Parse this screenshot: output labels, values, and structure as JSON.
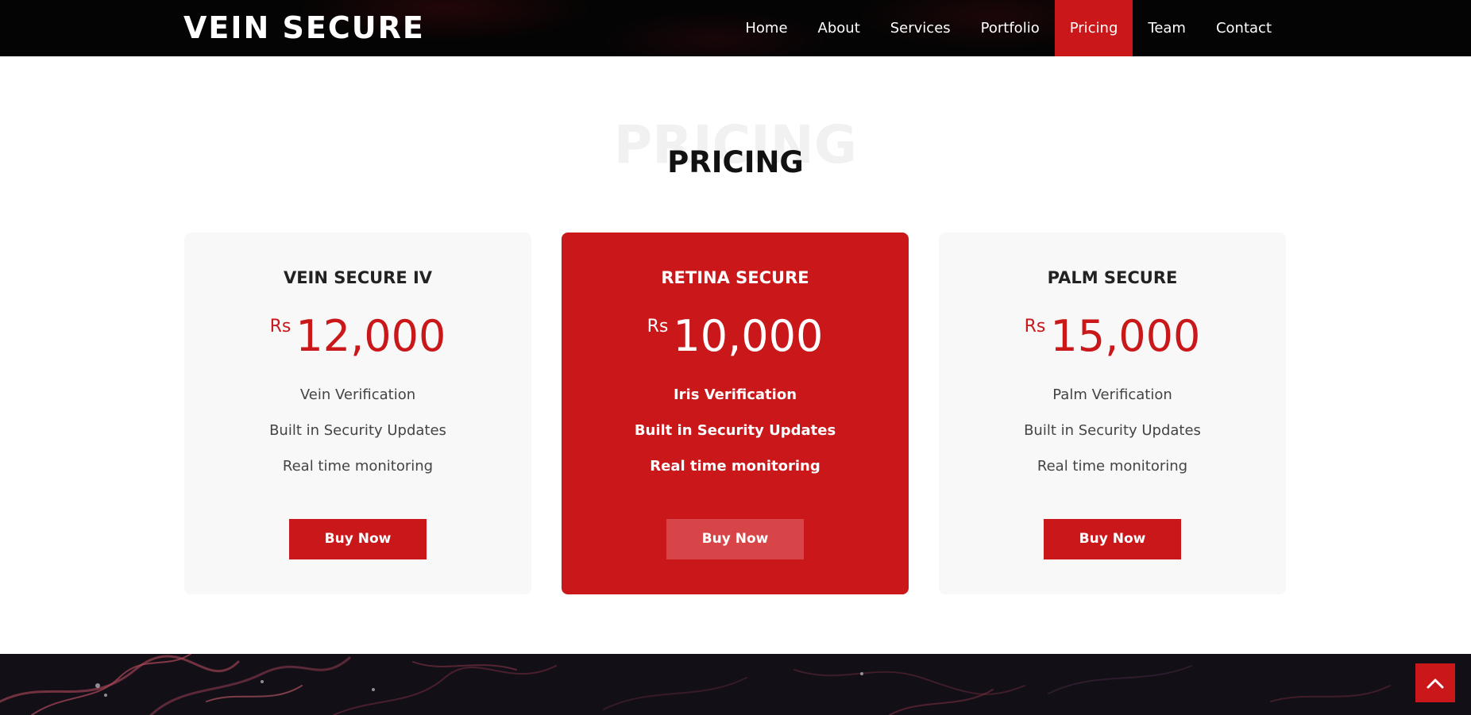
{
  "brand": {
    "name": "VEIN SECURE"
  },
  "nav": {
    "items": [
      {
        "label": "Home"
      },
      {
        "label": "About"
      },
      {
        "label": "Services"
      },
      {
        "label": "Portfolio"
      },
      {
        "label": "Pricing",
        "active": true
      },
      {
        "label": "Team"
      },
      {
        "label": "Contact"
      }
    ]
  },
  "section": {
    "background_title": "PRICING",
    "title": "PRICING"
  },
  "plans": [
    {
      "name": "VEIN SECURE IV",
      "currency": "Rs",
      "amount": "12,000",
      "features": [
        "Vein Verification",
        "Built in Security Updates",
        "Real time monitoring"
      ],
      "button": "Buy Now",
      "featured": false
    },
    {
      "name": "RETINA SECURE",
      "currency": "Rs",
      "amount": "10,000",
      "features": [
        "Iris Verification",
        "Built in Security Updates",
        "Real time monitoring"
      ],
      "button": "Buy Now",
      "featured": true
    },
    {
      "name": "PALM SECURE",
      "currency": "Rs",
      "amount": "15,000",
      "features": [
        "Palm Verification",
        "Built in Security Updates",
        "Real time monitoring"
      ],
      "button": "Buy Now",
      "featured": false
    }
  ],
  "back_to_top": {
    "icon": "chevron-up-icon"
  },
  "colors": {
    "accent": "#c9171a",
    "navbar_bg": "#050404",
    "card_bg": "#f8f8f8",
    "featured_button_bg": "#d84548",
    "bottom_band_bg": "#120f17"
  }
}
